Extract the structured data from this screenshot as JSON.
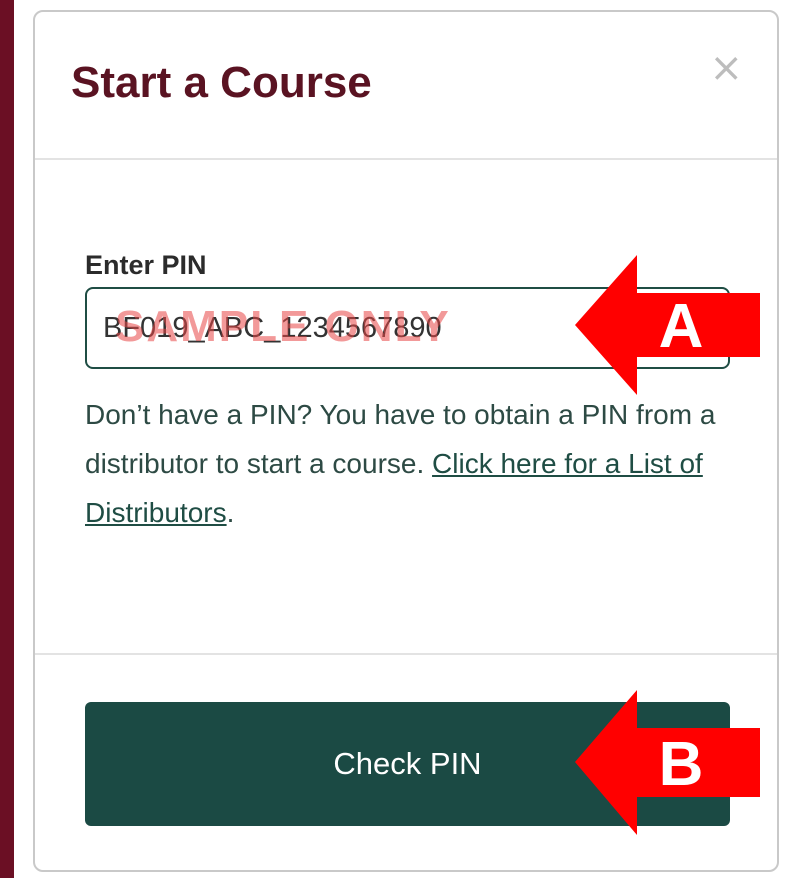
{
  "modal": {
    "title": "Start a Course",
    "close_glyph": "×"
  },
  "form": {
    "pin_label": "Enter PIN",
    "pin_value": "BF019_ABC_1234567890",
    "watermark": "SAMPLE ONLY",
    "help_text_prefix": "Don’t have a PIN? You have to obtain a PIN from a distributor to start a course. ",
    "help_link": "Click here for a List of Distributors",
    "help_text_suffix": "."
  },
  "actions": {
    "check_pin_label": "Check PIN"
  },
  "annotations": {
    "callout_a": "A",
    "callout_b": "B"
  },
  "colors": {
    "brand_maroon": "#6b0f24",
    "title_color": "#5a1322",
    "primary_green": "#1b4a44",
    "callout_red": "#ff0000"
  }
}
